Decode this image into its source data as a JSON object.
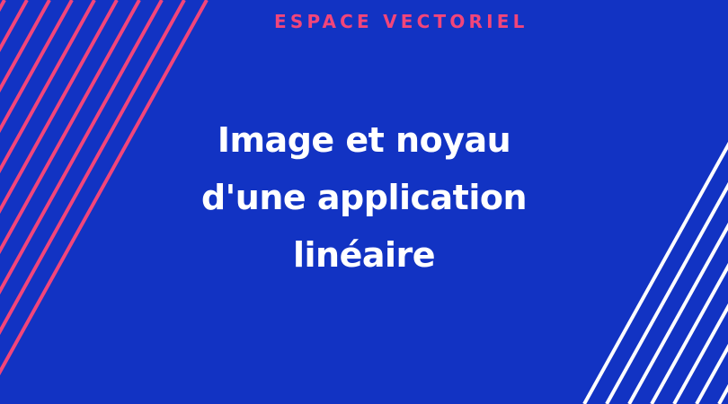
{
  "header": {
    "category": "ESPACE VECTORIEL"
  },
  "title": {
    "line1": "Image et noyau",
    "line2": "d'une application",
    "line3": "linéaire"
  },
  "colors": {
    "background": "#1233c3",
    "accent": "#f2457a",
    "text": "#ffffff"
  },
  "decoration": {
    "left_stripes_color": "#f2457a",
    "right_stripes_color": "#ffffff"
  }
}
